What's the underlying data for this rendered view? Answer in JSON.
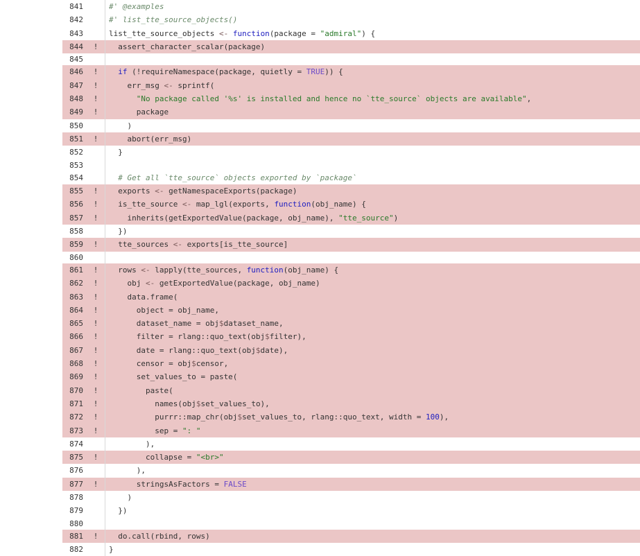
{
  "colors": {
    "uncovered_bg": "#ebc6c6",
    "comment": "#6a8a6a",
    "keyword": "#2020c0",
    "string": "#2a7a2a",
    "number": "#2020c0",
    "constant": "#6b4ac8"
  },
  "lines": [
    {
      "n": "841",
      "cov": "",
      "hit": false,
      "tokens": [
        [
          "comment",
          "#' @examples"
        ]
      ]
    },
    {
      "n": "842",
      "cov": "",
      "hit": false,
      "tokens": [
        [
          "comment",
          "#' list_tte_source_objects()"
        ]
      ]
    },
    {
      "n": "843",
      "cov": "",
      "hit": false,
      "tokens": [
        [
          "plain",
          "list_tte_source_objects "
        ],
        [
          "op",
          "<-"
        ],
        [
          "plain",
          " "
        ],
        [
          "keyword",
          "function"
        ],
        [
          "plain",
          "(package = "
        ],
        [
          "string",
          "\"admiral\""
        ],
        [
          "plain",
          ") {"
        ]
      ]
    },
    {
      "n": "844",
      "cov": "!",
      "hit": true,
      "tokens": [
        [
          "plain",
          "  assert_character_scalar(package)"
        ]
      ]
    },
    {
      "n": "845",
      "cov": "",
      "hit": false,
      "tokens": []
    },
    {
      "n": "846",
      "cov": "!",
      "hit": true,
      "tokens": [
        [
          "plain",
          "  "
        ],
        [
          "keyword",
          "if"
        ],
        [
          "plain",
          " (!requireNamespace(package, quietly = "
        ],
        [
          "const",
          "TRUE"
        ],
        [
          "plain",
          ")) {"
        ]
      ]
    },
    {
      "n": "847",
      "cov": "!",
      "hit": true,
      "tokens": [
        [
          "plain",
          "    err_msg "
        ],
        [
          "op",
          "<-"
        ],
        [
          "plain",
          " sprintf("
        ]
      ]
    },
    {
      "n": "848",
      "cov": "!",
      "hit": true,
      "tokens": [
        [
          "plain",
          "      "
        ],
        [
          "string",
          "\"No package called '%s' is installed and hence no `tte_source` objects are available\""
        ],
        [
          "plain",
          ","
        ]
      ]
    },
    {
      "n": "849",
      "cov": "!",
      "hit": true,
      "tokens": [
        [
          "plain",
          "      package"
        ]
      ]
    },
    {
      "n": "850",
      "cov": "",
      "hit": false,
      "tokens": [
        [
          "plain",
          "    )"
        ]
      ]
    },
    {
      "n": "851",
      "cov": "!",
      "hit": true,
      "tokens": [
        [
          "plain",
          "    abort(err_msg)"
        ]
      ]
    },
    {
      "n": "852",
      "cov": "",
      "hit": false,
      "tokens": [
        [
          "plain",
          "  }"
        ]
      ]
    },
    {
      "n": "853",
      "cov": "",
      "hit": false,
      "tokens": []
    },
    {
      "n": "854",
      "cov": "",
      "hit": false,
      "tokens": [
        [
          "plain",
          "  "
        ],
        [
          "comment",
          "# Get all `tte_source` objects exported by `package`"
        ]
      ]
    },
    {
      "n": "855",
      "cov": "!",
      "hit": true,
      "tokens": [
        [
          "plain",
          "  exports "
        ],
        [
          "op",
          "<-"
        ],
        [
          "plain",
          " getNamespaceExports(package)"
        ]
      ]
    },
    {
      "n": "856",
      "cov": "!",
      "hit": true,
      "tokens": [
        [
          "plain",
          "  is_tte_source "
        ],
        [
          "op",
          "<-"
        ],
        [
          "plain",
          " map_lgl(exports, "
        ],
        [
          "keyword",
          "function"
        ],
        [
          "plain",
          "(obj_name) {"
        ]
      ]
    },
    {
      "n": "857",
      "cov": "!",
      "hit": true,
      "tokens": [
        [
          "plain",
          "    inherits(getExportedValue(package, obj_name), "
        ],
        [
          "string",
          "\"tte_source\""
        ],
        [
          "plain",
          ")"
        ]
      ]
    },
    {
      "n": "858",
      "cov": "",
      "hit": false,
      "tokens": [
        [
          "plain",
          "  })"
        ]
      ]
    },
    {
      "n": "859",
      "cov": "!",
      "hit": true,
      "tokens": [
        [
          "plain",
          "  tte_sources "
        ],
        [
          "op",
          "<-"
        ],
        [
          "plain",
          " exports[is_tte_source]"
        ]
      ]
    },
    {
      "n": "860",
      "cov": "",
      "hit": false,
      "tokens": []
    },
    {
      "n": "861",
      "cov": "!",
      "hit": true,
      "tokens": [
        [
          "plain",
          "  rows "
        ],
        [
          "op",
          "<-"
        ],
        [
          "plain",
          " lapply(tte_sources, "
        ],
        [
          "keyword",
          "function"
        ],
        [
          "plain",
          "(obj_name) {"
        ]
      ]
    },
    {
      "n": "862",
      "cov": "!",
      "hit": true,
      "tokens": [
        [
          "plain",
          "    obj "
        ],
        [
          "op",
          "<-"
        ],
        [
          "plain",
          " getExportedValue(package, obj_name)"
        ]
      ]
    },
    {
      "n": "863",
      "cov": "!",
      "hit": true,
      "tokens": [
        [
          "plain",
          "    data.frame("
        ]
      ]
    },
    {
      "n": "864",
      "cov": "!",
      "hit": true,
      "tokens": [
        [
          "plain",
          "      object = obj_name,"
        ]
      ]
    },
    {
      "n": "865",
      "cov": "!",
      "hit": true,
      "tokens": [
        [
          "plain",
          "      dataset_name = obj"
        ],
        [
          "op",
          "$"
        ],
        [
          "plain",
          "dataset_name,"
        ]
      ]
    },
    {
      "n": "866",
      "cov": "!",
      "hit": true,
      "tokens": [
        [
          "plain",
          "      filter = rlang::quo_text(obj"
        ],
        [
          "op",
          "$"
        ],
        [
          "plain",
          "filter),"
        ]
      ]
    },
    {
      "n": "867",
      "cov": "!",
      "hit": true,
      "tokens": [
        [
          "plain",
          "      date = rlang::quo_text(obj"
        ],
        [
          "op",
          "$"
        ],
        [
          "plain",
          "date),"
        ]
      ]
    },
    {
      "n": "868",
      "cov": "!",
      "hit": true,
      "tokens": [
        [
          "plain",
          "      censor = obj"
        ],
        [
          "op",
          "$"
        ],
        [
          "plain",
          "censor,"
        ]
      ]
    },
    {
      "n": "869",
      "cov": "!",
      "hit": true,
      "tokens": [
        [
          "plain",
          "      set_values_to = paste("
        ]
      ]
    },
    {
      "n": "870",
      "cov": "!",
      "hit": true,
      "tokens": [
        [
          "plain",
          "        paste("
        ]
      ]
    },
    {
      "n": "871",
      "cov": "!",
      "hit": true,
      "tokens": [
        [
          "plain",
          "          names(obj"
        ],
        [
          "op",
          "$"
        ],
        [
          "plain",
          "set_values_to),"
        ]
      ]
    },
    {
      "n": "872",
      "cov": "!",
      "hit": true,
      "tokens": [
        [
          "plain",
          "          purrr::map_chr(obj"
        ],
        [
          "op",
          "$"
        ],
        [
          "plain",
          "set_values_to, rlang::quo_text, width = "
        ],
        [
          "number",
          "100"
        ],
        [
          "plain",
          "),"
        ]
      ]
    },
    {
      "n": "873",
      "cov": "!",
      "hit": true,
      "tokens": [
        [
          "plain",
          "          sep = "
        ],
        [
          "string",
          "\": \""
        ]
      ]
    },
    {
      "n": "874",
      "cov": "",
      "hit": false,
      "tokens": [
        [
          "plain",
          "        ),"
        ]
      ]
    },
    {
      "n": "875",
      "cov": "!",
      "hit": true,
      "tokens": [
        [
          "plain",
          "        collapse = "
        ],
        [
          "string",
          "\"<br>\""
        ]
      ]
    },
    {
      "n": "876",
      "cov": "",
      "hit": false,
      "tokens": [
        [
          "plain",
          "      ),"
        ]
      ]
    },
    {
      "n": "877",
      "cov": "!",
      "hit": true,
      "tokens": [
        [
          "plain",
          "      stringsAsFactors = "
        ],
        [
          "const",
          "FALSE"
        ]
      ]
    },
    {
      "n": "878",
      "cov": "",
      "hit": false,
      "tokens": [
        [
          "plain",
          "    )"
        ]
      ]
    },
    {
      "n": "879",
      "cov": "",
      "hit": false,
      "tokens": [
        [
          "plain",
          "  })"
        ]
      ]
    },
    {
      "n": "880",
      "cov": "",
      "hit": false,
      "tokens": []
    },
    {
      "n": "881",
      "cov": "!",
      "hit": true,
      "tokens": [
        [
          "plain",
          "  do.call(rbind, rows)"
        ]
      ]
    },
    {
      "n": "882",
      "cov": "",
      "hit": false,
      "tokens": [
        [
          "plain",
          "}"
        ]
      ]
    }
  ]
}
